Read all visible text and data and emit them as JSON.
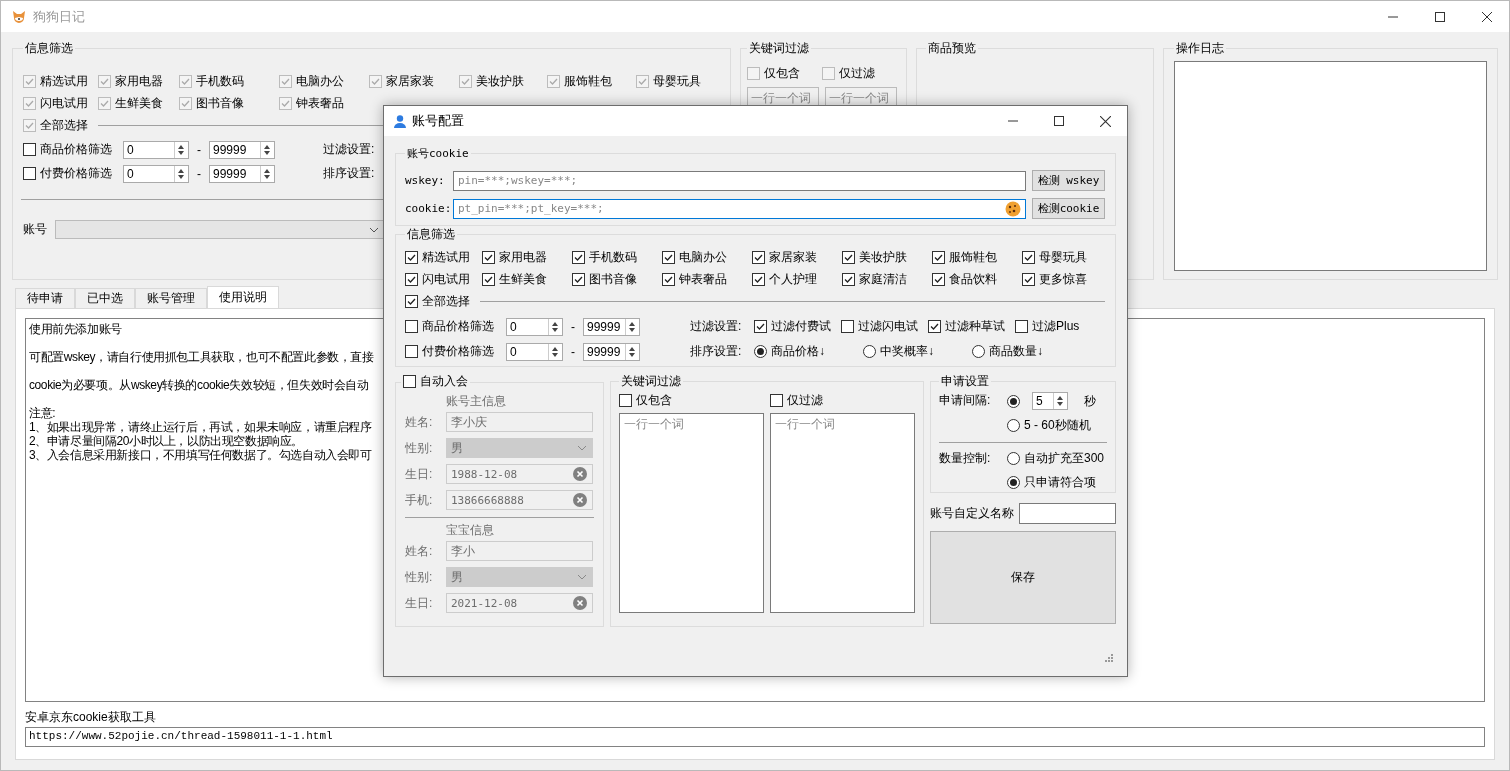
{
  "window": {
    "title": "狗狗日记"
  },
  "filter": {
    "title": "信息筛选",
    "categories": [
      {
        "label": "精选试用",
        "checked": true,
        "disabled": true
      },
      {
        "label": "家用电器",
        "checked": true,
        "disabled": true
      },
      {
        "label": "手机数码",
        "checked": true,
        "disabled": true
      },
      {
        "label": "电脑办公",
        "checked": true,
        "disabled": true
      },
      {
        "label": "家居家装",
        "checked": true,
        "disabled": true
      },
      {
        "label": "美妆护肤",
        "checked": true,
        "disabled": true
      },
      {
        "label": "服饰鞋包",
        "checked": true,
        "disabled": true
      },
      {
        "label": "母婴玩具",
        "checked": true,
        "disabled": true
      },
      {
        "label": "闪电试用",
        "checked": true,
        "disabled": true
      },
      {
        "label": "生鲜美食",
        "checked": true,
        "disabled": true
      },
      {
        "label": "图书音像",
        "checked": true,
        "disabled": true
      },
      {
        "label": "钟表奢品",
        "checked": true,
        "disabled": true
      }
    ],
    "select_all": {
      "label": "全部选择",
      "checked": true,
      "disabled": true
    },
    "price_filters": [
      {
        "label": "商品价格筛选",
        "checked": false,
        "disabled": false,
        "min": "0",
        "max": "99999"
      },
      {
        "label": "付费价格筛选",
        "checked": false,
        "disabled": false,
        "min": "0",
        "max": "99999"
      }
    ],
    "dash": "-",
    "filter_label": "过滤设置:",
    "sort_label": "排序设置:",
    "account_label": "账号"
  },
  "keyword_filter": {
    "title": "关键词过滤",
    "options": [
      {
        "label": "仅包含",
        "checked": false,
        "disabled": true
      },
      {
        "label": "仅过滤",
        "checked": false,
        "disabled": true
      }
    ],
    "placeholders": [
      "一行一个词",
      "一行一个词"
    ]
  },
  "preview": {
    "title": "商品预览"
  },
  "log": {
    "title": "操作日志"
  },
  "tabs": [
    {
      "label": "待申请",
      "selected": false
    },
    {
      "label": "已中选",
      "selected": false
    },
    {
      "label": "账号管理",
      "selected": false
    },
    {
      "label": "使用说明",
      "selected": true
    }
  ],
  "instructions": [
    [
      "使用前先添加账号"
    ],
    [
      "可配置wskey，请自行使用抓包工具获取，也可不配置此参数，直接"
    ],
    [
      "cookie为必要项。从wskey转换的cookie失效较短，但失效时会自动"
    ],
    [
      "注意:",
      "1、如果出现异常，请终止运行后，再试，如果未响应，请重启程序",
      "2、申请尽量间隔20小时以上，以防出现空数据响应。",
      "3、入会信息采用新接口，不用填写任何数据了。勾选自动入会即可"
    ]
  ],
  "tool": {
    "label": "安卓京东cookie获取工具",
    "url": "https://www.52pojie.cn/thread-1598011-1-1.html"
  },
  "dialog": {
    "title": "账号配置",
    "cookie": {
      "title": "账号cookie",
      "fields": [
        {
          "label": "wskey:",
          "placeholder": "pin=***;wskey=***;",
          "button": "检测 wskey",
          "focused": false
        },
        {
          "label": "cookie:",
          "placeholder": "pt_pin=***;pt_key=***;",
          "button": "检测cookie",
          "focused": true
        }
      ]
    },
    "filter": {
      "title": "信息筛选",
      "categories": [
        {
          "label": "精选试用",
          "checked": true
        },
        {
          "label": "家用电器",
          "checked": true
        },
        {
          "label": "手机数码",
          "checked": true
        },
        {
          "label": "电脑办公",
          "checked": true
        },
        {
          "label": "家居家装",
          "checked": true
        },
        {
          "label": "美妆护肤",
          "checked": true
        },
        {
          "label": "服饰鞋包",
          "checked": true
        },
        {
          "label": "母婴玩具",
          "checked": true
        },
        {
          "label": "闪电试用",
          "checked": true
        },
        {
          "label": "生鲜美食",
          "checked": true
        },
        {
          "label": "图书音像",
          "checked": true
        },
        {
          "label": "钟表奢品",
          "checked": true
        },
        {
          "label": "个人护理",
          "checked": true
        },
        {
          "label": "家庭清洁",
          "checked": true
        },
        {
          "label": "食品饮料",
          "checked": true
        },
        {
          "label": "更多惊喜",
          "checked": true
        }
      ],
      "select_all": {
        "label": "全部选择",
        "checked": true
      },
      "price_filters": [
        {
          "label": "商品价格筛选",
          "checked": false,
          "min": "0",
          "max": "99999"
        },
        {
          "label": "付费价格筛选",
          "checked": false,
          "min": "0",
          "max": "99999"
        }
      ],
      "dash": "-",
      "filter_label": "过滤设置:",
      "filter_options": [
        {
          "label": "过滤付费试",
          "checked": true
        },
        {
          "label": "过滤闪电试",
          "checked": false
        },
        {
          "label": "过滤种草试",
          "checked": true
        },
        {
          "label": "过滤Plus",
          "checked": false
        }
      ],
      "sort_label": "排序设置:",
      "sort_options": [
        {
          "label": "商品价格↓",
          "selected": true
        },
        {
          "label": "中奖概率↓",
          "selected": false
        },
        {
          "label": "商品数量↓",
          "selected": false
        }
      ]
    },
    "membership": {
      "label": "自动入会",
      "checked": false,
      "disabled": true,
      "sections": [
        {
          "title": "账号主信息",
          "fields": [
            {
              "kind": "text",
              "label": "姓名:",
              "value": "李小庆"
            },
            {
              "kind": "select",
              "label": "性别:",
              "value": "男"
            },
            {
              "kind": "clearable",
              "label": "生日:",
              "value": "1988-12-08"
            },
            {
              "kind": "clearable",
              "label": "手机:",
              "value": "13866668888"
            }
          ]
        },
        {
          "title": "宝宝信息",
          "fields": [
            {
              "kind": "text",
              "label": "姓名:",
              "value": "李小"
            },
            {
              "kind": "select",
              "label": "性别:",
              "value": "男"
            },
            {
              "kind": "clearable",
              "label": "生日:",
              "value": "2021-12-08"
            }
          ]
        }
      ]
    },
    "keywords": {
      "title": "关键词过滤",
      "columns": [
        {
          "label": "仅包含",
          "checked": false,
          "placeholder": "一行一个词"
        },
        {
          "label": "仅过滤",
          "checked": false,
          "placeholder": "一行一个词"
        }
      ]
    },
    "apply": {
      "title": "申请设置",
      "interval_label": "申请间隔:",
      "interval_options": [
        {
          "kind": "spin",
          "value": "5",
          "unit": "秒",
          "selected": true
        },
        {
          "kind": "text",
          "label": "5 - 60秒随机",
          "selected": false
        }
      ],
      "count_label": "数量控制:",
      "count_options": [
        {
          "label": "自动扩充至300",
          "selected": false
        },
        {
          "label": "只申请符合项",
          "selected": true
        }
      ]
    },
    "custom_name": {
      "label": "账号自定义名称"
    },
    "save": "保存"
  }
}
